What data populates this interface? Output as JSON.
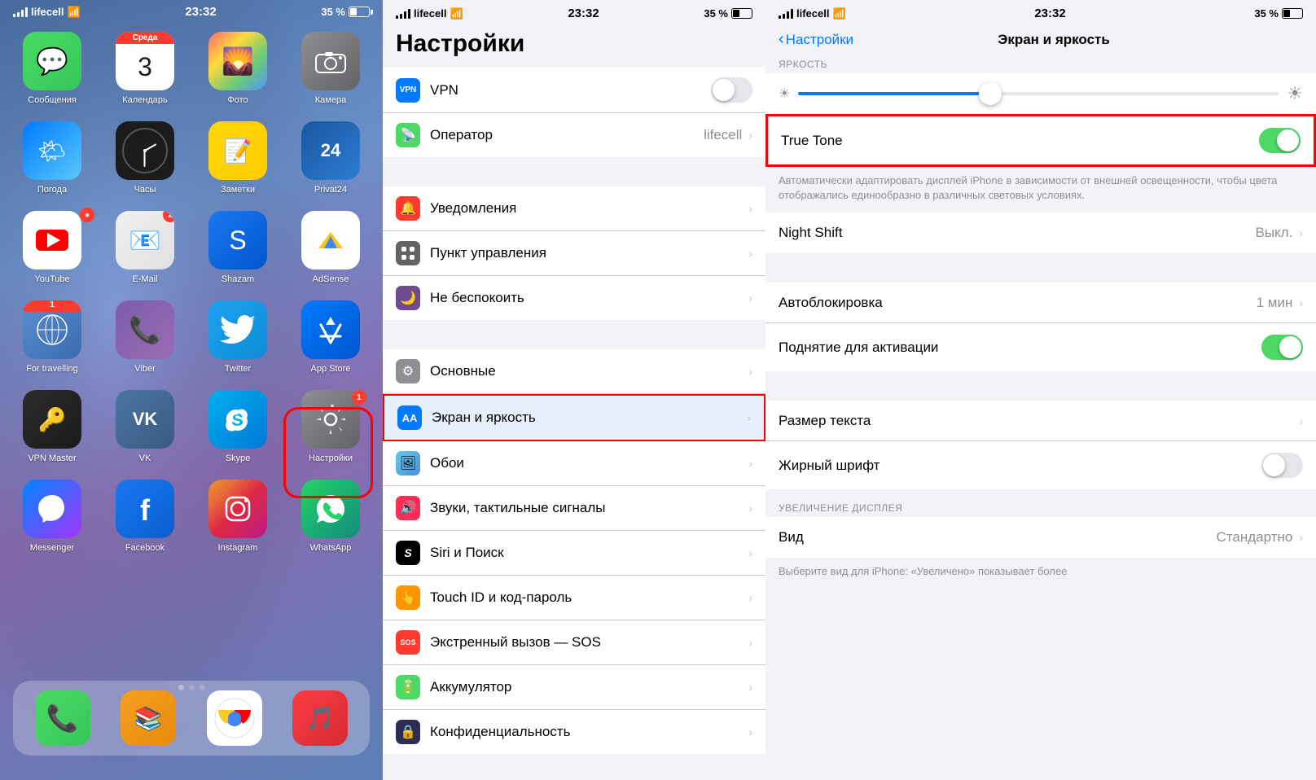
{
  "panel1": {
    "carrier": "lifecell",
    "time": "23:32",
    "battery": "35 %",
    "apps_row1": [
      {
        "label": "Сообщения",
        "color": "messages",
        "icon": "💬"
      },
      {
        "label": "Календарь",
        "color": "calendar",
        "icon": "cal"
      },
      {
        "label": "Фото",
        "color": "photos",
        "icon": "🌄"
      },
      {
        "label": "Камера",
        "color": "camera",
        "icon": "📷"
      }
    ],
    "apps_row2": [
      {
        "label": "Погода",
        "color": "weather",
        "icon": "🌤"
      },
      {
        "label": "Часы",
        "color": "clock",
        "icon": "clock"
      },
      {
        "label": "Заметки",
        "color": "notes",
        "icon": "📝"
      },
      {
        "label": "Privat24",
        "color": "privat24",
        "icon": "24"
      }
    ],
    "apps_row3": [
      {
        "label": "YouTube",
        "color": "youtube",
        "icon": "▶"
      },
      {
        "label": "E-Mail",
        "color": "email",
        "icon": "✉"
      },
      {
        "label": "Shazam",
        "color": "shazam",
        "icon": "S"
      },
      {
        "label": "AdSense",
        "color": "adsense",
        "icon": "A"
      }
    ],
    "apps_row4": [
      {
        "label": "For travelling",
        "color": "fortravelling",
        "icon": "🗺"
      },
      {
        "label": "Viber",
        "color": "viber",
        "icon": "V"
      },
      {
        "label": "Twitter",
        "color": "twitter",
        "icon": "🐦"
      },
      {
        "label": "App Store",
        "color": "appstore",
        "icon": "A"
      }
    ],
    "apps_row5": [
      {
        "label": "VPN Master",
        "color": "vpnmaster",
        "icon": "🔑"
      },
      {
        "label": "VK",
        "color": "vk",
        "icon": "VK"
      },
      {
        "label": "Skype",
        "color": "skype",
        "icon": "S"
      },
      {
        "label": "Настройки",
        "color": "settings",
        "icon": "⚙"
      }
    ],
    "apps_row6": [
      {
        "label": "Messenger",
        "color": "messenger",
        "icon": "M"
      },
      {
        "label": "Facebook",
        "color": "facebook",
        "icon": "f"
      },
      {
        "label": "Instagram",
        "color": "instagram",
        "icon": "📷"
      },
      {
        "label": "WhatsApp",
        "color": "whatsapp",
        "icon": "W"
      }
    ],
    "dock": [
      {
        "label": "Телефон",
        "color": "phone",
        "icon": "📞"
      },
      {
        "label": "Книги",
        "color": "books",
        "icon": "📚"
      },
      {
        "label": "Chrome",
        "color": "chrome",
        "icon": "C"
      },
      {
        "label": "Музыка",
        "color": "music",
        "icon": "🎵"
      }
    ]
  },
  "panel2": {
    "carrier": "lifecell",
    "time": "23:32",
    "battery": "35 %",
    "title": "Настройки",
    "rows": [
      {
        "label": "VPN",
        "icon_class": "icon-vpn",
        "icon_text": "VPN",
        "value": "",
        "has_toggle": true,
        "toggle_on": false
      },
      {
        "label": "Оператор",
        "icon_class": "icon-operator",
        "icon_text": "📡",
        "value": "lifecell",
        "has_chevron": true
      },
      {
        "label": "Уведомления",
        "icon_class": "icon-notifications",
        "icon_text": "🔔",
        "value": "",
        "has_chevron": true
      },
      {
        "label": "Пункт управления",
        "icon_class": "icon-control",
        "icon_text": "⊞",
        "value": "",
        "has_chevron": true
      },
      {
        "label": "Не беспокоить",
        "icon_class": "icon-dnd",
        "icon_text": "🌙",
        "value": "",
        "has_chevron": true
      },
      {
        "label": "Основные",
        "icon_class": "icon-general",
        "icon_text": "⚙",
        "value": "",
        "has_chevron": true
      },
      {
        "label": "Экран и яркость",
        "icon_class": "icon-display",
        "icon_text": "AA",
        "value": "",
        "has_chevron": true,
        "highlighted": true
      },
      {
        "label": "Обои",
        "icon_class": "icon-wallpaper",
        "icon_text": "🖼",
        "value": "",
        "has_chevron": true
      },
      {
        "label": "Звуки, тактильные сигналы",
        "icon_class": "icon-sounds",
        "icon_text": "🔊",
        "value": "",
        "has_chevron": true
      },
      {
        "label": "Siri и Поиск",
        "icon_class": "icon-siri",
        "icon_text": "S",
        "value": "",
        "has_chevron": true
      },
      {
        "label": "Touch ID и код-пароль",
        "icon_class": "icon-touchid",
        "icon_text": "👆",
        "value": "",
        "has_chevron": true
      },
      {
        "label": "Экстренный вызов — SOS",
        "icon_class": "icon-sos",
        "icon_text": "SOS",
        "value": "",
        "has_chevron": true
      },
      {
        "label": "Аккумулятор",
        "icon_class": "icon-battery",
        "icon_text": "🔋",
        "value": "",
        "has_chevron": true
      },
      {
        "label": "Конфиденциальность",
        "icon_class": "icon-privacy",
        "icon_text": "🔒",
        "value": "",
        "has_chevron": true
      }
    ]
  },
  "panel3": {
    "carrier": "lifecell",
    "time": "23:32",
    "battery": "35 %",
    "back_label": "Настройки",
    "title": "Экран и яркость",
    "brightness_label": "ЯРКОСТЬ",
    "brightness_level": 40,
    "rows_top": [
      {
        "label": "True Tone",
        "toggle": true,
        "toggle_on": true,
        "highlighted": true
      },
      {
        "label": "Night Shift",
        "value": "Выкл.",
        "has_chevron": true
      }
    ],
    "true_tone_desc": "Автоматически адаптировать дисплей iPhone в зависимости от внешней освещенности, чтобы цвета отображались единообразно в различных световых условиях.",
    "rows_mid": [
      {
        "label": "Автоблокировка",
        "value": "1 мин",
        "has_chevron": true
      },
      {
        "label": "Поднятие для активации",
        "toggle": true,
        "toggle_on": true
      }
    ],
    "rows_bot": [
      {
        "label": "Размер текста",
        "has_chevron": true
      },
      {
        "label": "Жирный шрифт",
        "toggle": true,
        "toggle_on": false
      }
    ],
    "zoom_label": "УВЕЛИЧЕНИЕ ДИСПЛЕЯ",
    "rows_zoom": [
      {
        "label": "Вид",
        "value": "Стандартно",
        "has_chevron": true
      }
    ],
    "zoom_desc": "Выберите вид для iPhone: «Увеличено» показывает более"
  }
}
